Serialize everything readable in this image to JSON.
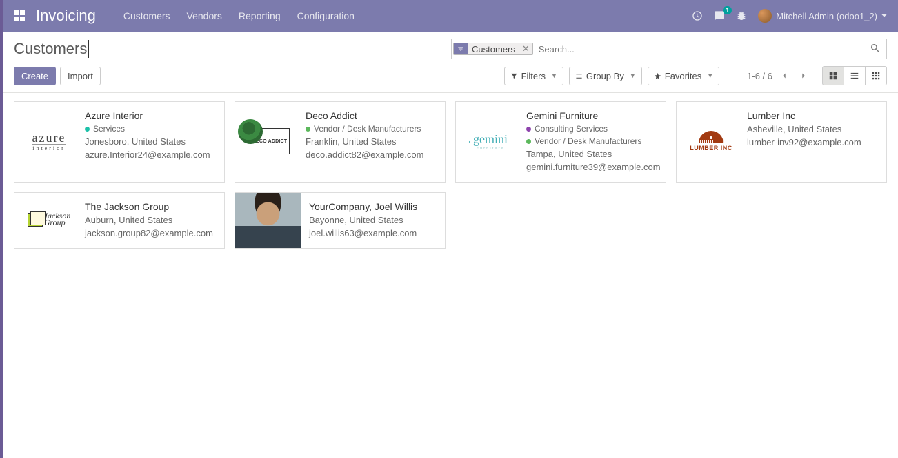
{
  "nav": {
    "brand": "Invoicing",
    "menu": [
      "Customers",
      "Vendors",
      "Reporting",
      "Configuration"
    ],
    "messages_badge": "1",
    "user": "Mitchell Admin (odoo1_2)"
  },
  "cp": {
    "breadcrumb": "Customers",
    "search_facet": "Customers",
    "search_placeholder": "Search...",
    "create": "Create",
    "import": "Import",
    "filters": "Filters",
    "group_by": "Group By",
    "favorites": "Favorites",
    "pager": "1-6 / 6"
  },
  "tags": {
    "services": "Services",
    "vendor_desk": "Vendor / Desk Manufacturers",
    "consulting": "Consulting Services"
  },
  "colors": {
    "teal": "#1cc1a9",
    "green": "#5cb85c",
    "purple": "#8e44ad"
  },
  "cards": [
    {
      "name": "Azure Interior",
      "tags": [
        {
          "key": "services",
          "color": "teal"
        }
      ],
      "location": "Jonesboro, United States",
      "email": "azure.Interior24@example.com",
      "logo": "azure"
    },
    {
      "name": "Deco Addict",
      "tags": [
        {
          "key": "vendor_desk",
          "color": "green"
        }
      ],
      "location": "Franklin, United States",
      "email": "deco.addict82@example.com",
      "logo": "deco"
    },
    {
      "name": "Gemini Furniture",
      "tags": [
        {
          "key": "consulting",
          "color": "purple"
        },
        {
          "key": "vendor_desk",
          "color": "green"
        }
      ],
      "location": "Tampa, United States",
      "email": "gemini.furniture39@example.com",
      "logo": "gemini"
    },
    {
      "name": "Lumber Inc",
      "tags": [],
      "location": "Asheville, United States",
      "email": "lumber-inv92@example.com",
      "logo": "lumber"
    },
    {
      "name": "The Jackson Group",
      "tags": [],
      "location": "Auburn, United States",
      "email": "jackson.group82@example.com",
      "logo": "jackson"
    },
    {
      "name": "YourCompany, Joel Willis",
      "tags": [],
      "location": "Bayonne, United States",
      "email": "joel.willis63@example.com",
      "logo": "photo"
    }
  ]
}
